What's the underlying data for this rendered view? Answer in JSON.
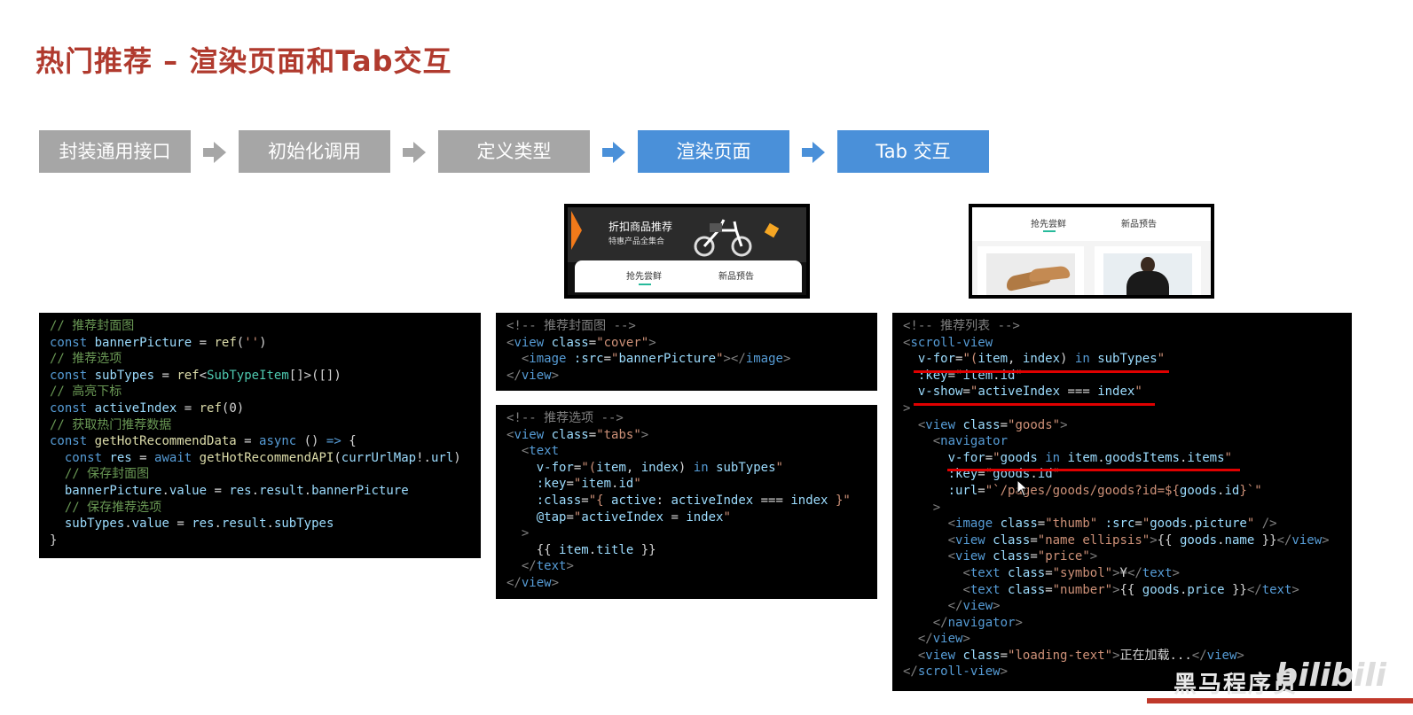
{
  "page": {
    "title": "热门推荐 – 渲染页面和Tab交互"
  },
  "steps": [
    {
      "label": "封装通用接口"
    },
    {
      "label": "初始化调用"
    },
    {
      "label": "定义类型"
    },
    {
      "label": "渲染页面"
    },
    {
      "label": "Tab 交互"
    }
  ],
  "preview1": {
    "banner_title": "折扣商品推荐",
    "banner_subtitle": "特惠产品全集合",
    "tab1": "抢先尝鲜",
    "tab2": "新品预告"
  },
  "preview2": {
    "tab1": "抢先尝鲜",
    "tab2": "新品预告"
  },
  "code1": {
    "l1": "// 推荐封面图",
    "l3": "// 推荐选项",
    "l5": "// 高亮下标",
    "l7": "// 获取热门推荐数据",
    "l10": "  // 保存封面图",
    "l12": "  // 保存推荐选项",
    "l14": "}"
  },
  "code2": {
    "l1": "<!-- 推荐封面图 -->"
  },
  "code3": {
    "l1": "<!-- 推荐选项 -->"
  },
  "code4": {
    "l1": "<!-- 推荐列表 -->",
    "l22": "正在加载..."
  },
  "watermark": {
    "text": "黑马程序员",
    "logo": "bilibili"
  },
  "colors": {
    "title": "#b03a2e",
    "step_gray": "#a6a6a6",
    "step_blue": "#4a90d9",
    "code_bg": "#000000",
    "underline": "#e00000"
  }
}
